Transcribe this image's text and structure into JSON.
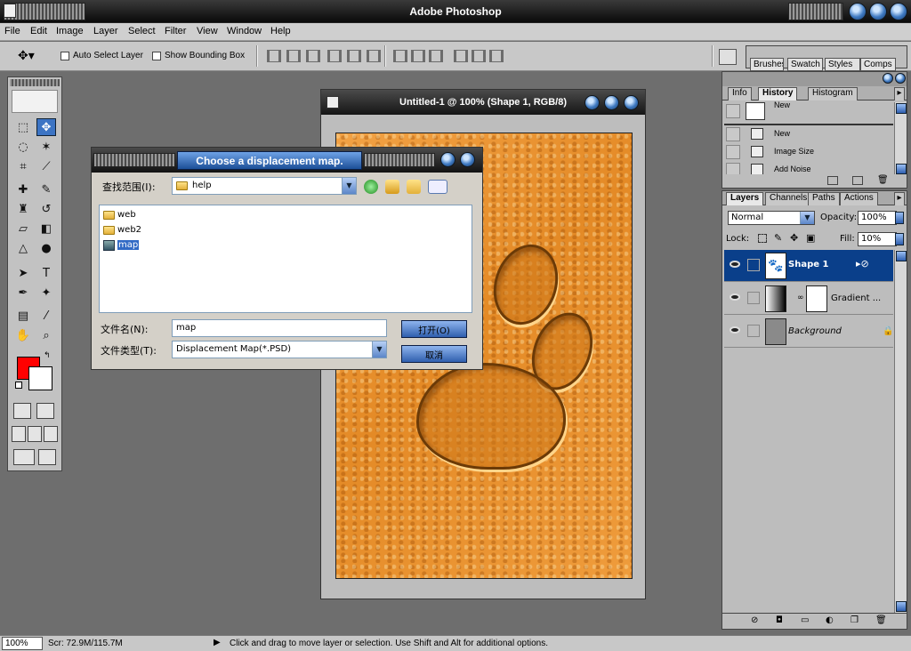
{
  "app": {
    "title": "Adobe Photoshop"
  },
  "menu": [
    "File",
    "Edit",
    "Image",
    "Layer",
    "Select",
    "Filter",
    "View",
    "Window",
    "Help"
  ],
  "options": {
    "auto_select": "Auto Select Layer",
    "bounding_box": "Show Bounding Box"
  },
  "palette_well": [
    "Brushes",
    "Swatch",
    "Styles",
    "Comps"
  ],
  "document": {
    "title": "Untitled-1 @ 100% (Shape 1, RGB/8)"
  },
  "dialog": {
    "title": "Choose a displacement map.",
    "look_in_label": "查找范围(I):",
    "look_in_value": "help",
    "files": [
      "web",
      "web2",
      "map"
    ],
    "selected_file": "map",
    "filename_label": "文件名(N):",
    "filename_value": "map",
    "filetype_label": "文件类型(T):",
    "filetype_value": "Displacement Map(*.PSD)",
    "open_button": "打开(O)",
    "cancel_button": "取消"
  },
  "history_panel": {
    "tabs": [
      "Info",
      "History",
      "Histogram"
    ],
    "snapshot_label": "New",
    "items": [
      "New",
      "Image Size",
      "Add Noise"
    ]
  },
  "layers_panel": {
    "tabs": [
      "Layers",
      "Channels",
      "Paths",
      "Actions"
    ],
    "blend_mode": "Normal",
    "opacity_label": "Opacity:",
    "opacity_value": "100%",
    "lock_label": "Lock:",
    "fill_label": "Fill:",
    "fill_value": "10%",
    "layers": [
      {
        "name": "Shape 1"
      },
      {
        "name": "Gradient ..."
      },
      {
        "name": "Background"
      }
    ]
  },
  "status": {
    "zoom": "100%",
    "scratch": "Scr: 72.9M/115.7M",
    "message": "Click and drag to move layer or selection.  Use Shift and Alt for additional options."
  }
}
